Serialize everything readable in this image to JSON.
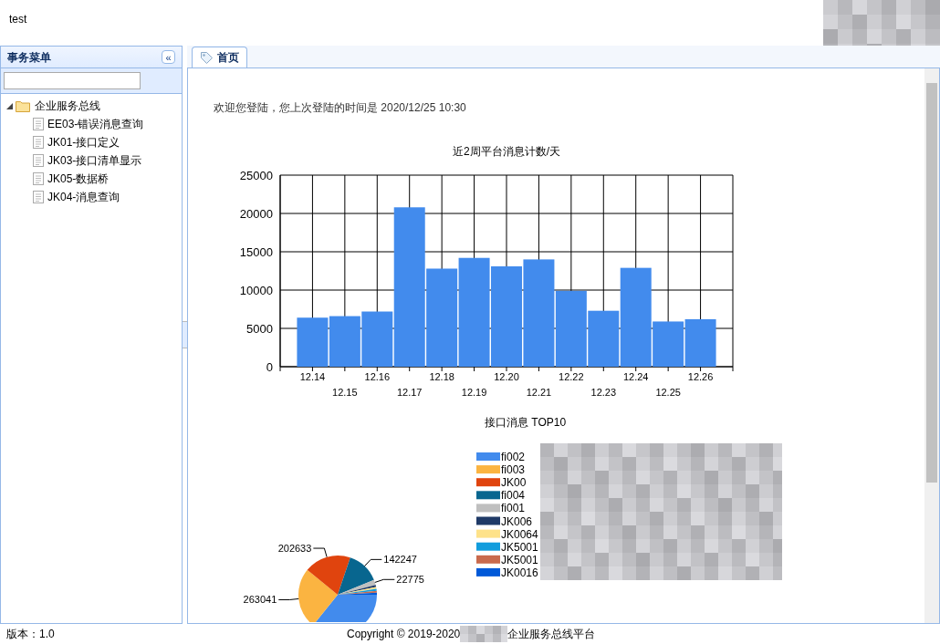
{
  "header": {
    "title": "test"
  },
  "sidebar": {
    "title": "事务菜单",
    "collapse_icon": "«",
    "tree": [
      {
        "label": "企业服务总线",
        "expanded": true,
        "children": [
          {
            "label": "EE03-错误消息查询"
          },
          {
            "label": "JK01-接口定义"
          },
          {
            "label": "JK03-接口清单显示"
          },
          {
            "label": "JK05-数据桥"
          },
          {
            "label": "JK04-消息查询"
          }
        ]
      }
    ]
  },
  "tabs": [
    {
      "label": "首页",
      "selected": true
    }
  ],
  "welcome": "欢迎您登陆，您上次登陆的时间是 2020/12/25 10:30",
  "bar_chart": {
    "chart_data": {
      "type": "bar",
      "title": "近2周平台消息计数/天",
      "grid": true,
      "categories": [
        "12.14",
        "12.15",
        "12.16",
        "12.17",
        "12.18",
        "12.19",
        "12.20",
        "12.21",
        "12.22",
        "12.23",
        "12.24",
        "12.25",
        "12.26"
      ],
      "series": [
        {
          "color": "#428bed",
          "values": [
            6400,
            6600,
            7200,
            20800,
            12800,
            14200,
            13100,
            14000,
            9900,
            7300,
            12900,
            5900,
            6200
          ]
        }
      ],
      "ylim": [
        0,
        25000
      ],
      "yticks": [
        0,
        5000,
        10000,
        15000,
        20000,
        25000
      ]
    }
  },
  "pie_chart": {
    "title": "接口消息  TOP10",
    "chart_data": {
      "type": "pie",
      "categories": [
        "fi002",
        "fi003",
        "JK00",
        "fi004",
        "fi001",
        "JK006",
        "JK0064",
        "JK5001",
        "JK5001",
        "JK0016"
      ],
      "series": [
        {
          "values": [
            35.8,
            25.1,
            19.3,
            13.6,
            2.2,
            0.8,
            0.8,
            0.8,
            0.8,
            0.8
          ]
        }
      ],
      "colors": [
        "#428bed",
        "#fbb441",
        "#e0440e",
        "#08668f",
        "#bfbfbf",
        "#1f3a67",
        "#fee28a",
        "#129ddd",
        "#c96a4d",
        "#0059d8"
      ],
      "legend": true,
      "value_labels": [
        null,
        "263041",
        "202633",
        "142247",
        "22775",
        null,
        null,
        null,
        null,
        null
      ]
    }
  },
  "footer": {
    "version": "版本：1.0",
    "copyright": "Copyright © 2019-2020",
    "platform": "企业服务总线平台"
  }
}
